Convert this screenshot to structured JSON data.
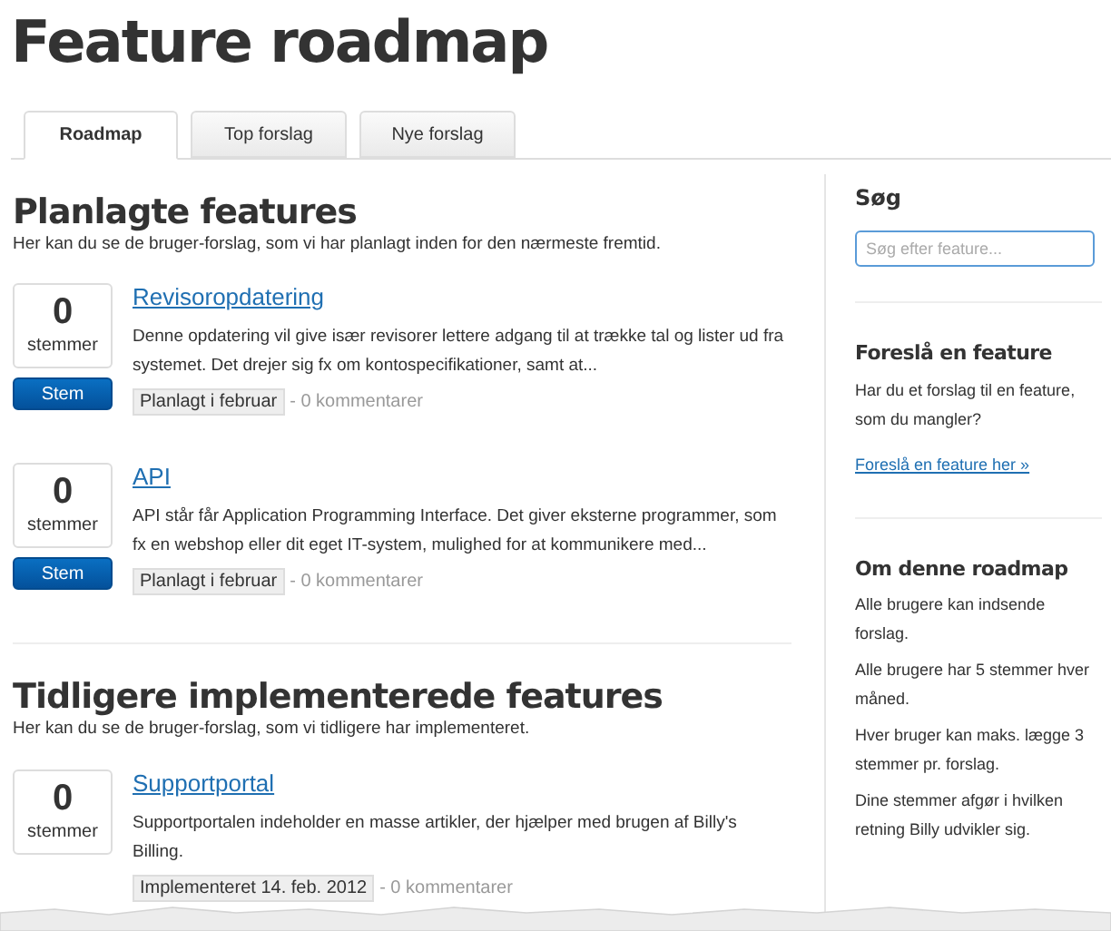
{
  "page": {
    "title": "Feature roadmap"
  },
  "tabs": [
    {
      "label": "Roadmap",
      "selected": true
    },
    {
      "label": "Top forslag",
      "selected": false
    },
    {
      "label": "Nye forslag",
      "selected": false
    }
  ],
  "sections": [
    {
      "heading": "Planlagte features",
      "description": "Her kan du se de bruger-forslag, som vi har planlagt inden for den nærmeste fremtid.",
      "items": [
        {
          "votes": "0",
          "votes_label": "stemmer",
          "vote_button": "Stem",
          "title": "Revisoropdatering",
          "description": "Denne opdatering vil give især revisorer lettere adgang til at trække tal og lister ud fra systemet. Det drejer sig fx om kontospecifikationer, samt at...",
          "status": "Planlagt i februar",
          "comments": "- 0 kommentarer"
        },
        {
          "votes": "0",
          "votes_label": "stemmer",
          "vote_button": "Stem",
          "title": "API",
          "description": "API står får Application Programming Interface. Det giver eksterne programmer, som fx en webshop eller dit eget IT-system, mulighed for at kommunikere med...",
          "status": "Planlagt i februar",
          "comments": "- 0 kommentarer"
        }
      ]
    },
    {
      "heading": "Tidligere implementerede features",
      "description": "Her kan du se de bruger-forslag, som vi tidligere har implementeret.",
      "items": [
        {
          "votes": "0",
          "votes_label": "stemmer",
          "title": "Supportportal",
          "description": "Supportportalen indeholder en masse artikler, der hjælper med brugen af Billy's Billing.",
          "status": "Implementeret 14. feb. 2012",
          "comments": "- 0 kommentarer"
        }
      ]
    }
  ],
  "sidebar": {
    "search": {
      "heading": "Søg",
      "placeholder": "Søg efter feature..."
    },
    "blocks": [
      {
        "heading": "Foreslå en feature",
        "paragraphs": [
          "Har du et forslag til en feature, som du mangler?"
        ],
        "link": "Foreslå en feature her »"
      },
      {
        "heading": "Om denne roadmap",
        "paragraphs": [
          "Alle brugere kan indsende forslag.",
          "Alle brugere har 5 stemmer hver måned.",
          "Hver bruger kan maks. lægge 3 stemmer pr. forslag.",
          "Dine stemmer afgør i hvilken retning Billy udvikler sig."
        ]
      }
    ]
  }
}
